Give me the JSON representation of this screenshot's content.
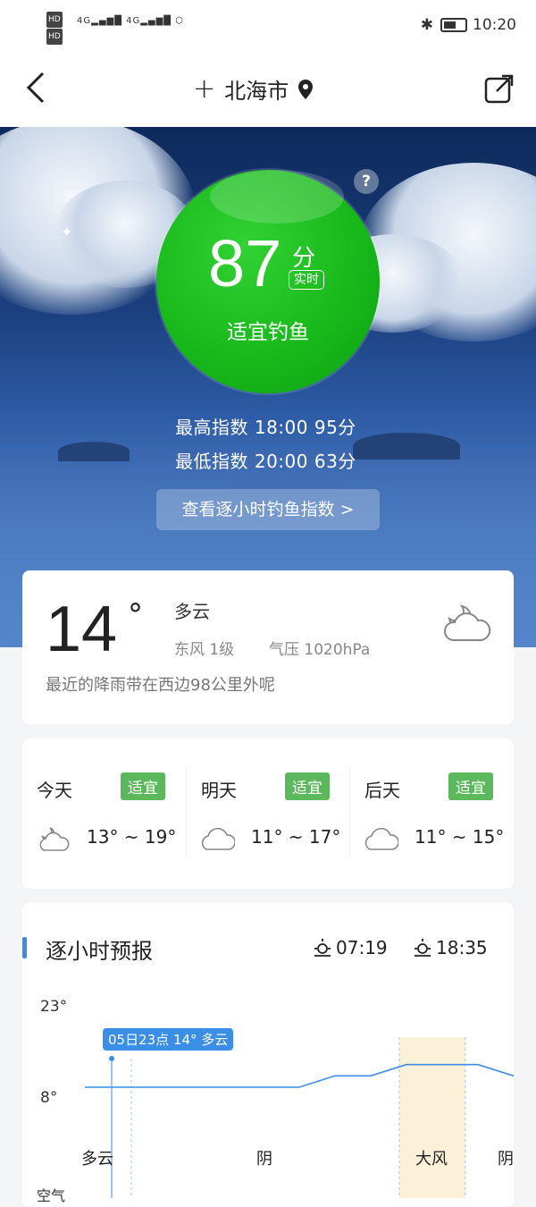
{
  "status_bar": {
    "hd1": "HD",
    "hd2": "HD",
    "signal1": "4G",
    "signal2": "4G",
    "time": "10:20"
  },
  "nav": {
    "back": "‹",
    "city": "北海市"
  },
  "fishing": {
    "score": "87",
    "unit": "分",
    "realtime": "实时",
    "suitability": "适宜钓鱼",
    "highest": "最高指数  18:00  95分",
    "lowest": "最低指数  20:00  63分",
    "hourly_button": "查看逐小时钓鱼指数 >",
    "help": "?"
  },
  "now": {
    "temp": "14",
    "deg": "°",
    "condition": "多云",
    "wind": "东风  1级",
    "pressure": "气压  1020hPa",
    "rain_note": "最近的降雨带在西边98公里外呢"
  },
  "days": [
    {
      "name": "今天",
      "badge": "适宜",
      "range": "13° ~ 19°",
      "icon": "partly-cloudy-night-icon"
    },
    {
      "name": "明天",
      "badge": "适宜",
      "range": "11° ~ 17°",
      "icon": "cloud-icon"
    },
    {
      "name": "后天",
      "badge": "适宜",
      "range": "11° ~ 15°",
      "icon": "cloud-icon"
    }
  ],
  "hourly": {
    "title": "逐小时预报",
    "sunrise": "07:19",
    "sunset": "18:35",
    "ymax": "23°",
    "ymin": "8°",
    "tooltip": "05日23点 14° 多云",
    "labels": [
      "多云",
      "阴",
      "大风",
      "阴"
    ],
    "air_quality_label": "空气"
  },
  "chart_data": {
    "type": "line",
    "ylim": [
      8,
      23
    ],
    "series": [
      {
        "values": [
          14,
          14,
          14,
          14,
          14,
          14,
          14,
          15,
          15,
          16,
          16,
          16,
          15
        ]
      }
    ]
  },
  "colors": {
    "accent": "#3b8ee5",
    "badge": "#5cb85c",
    "score_ball": "#18b91b"
  }
}
